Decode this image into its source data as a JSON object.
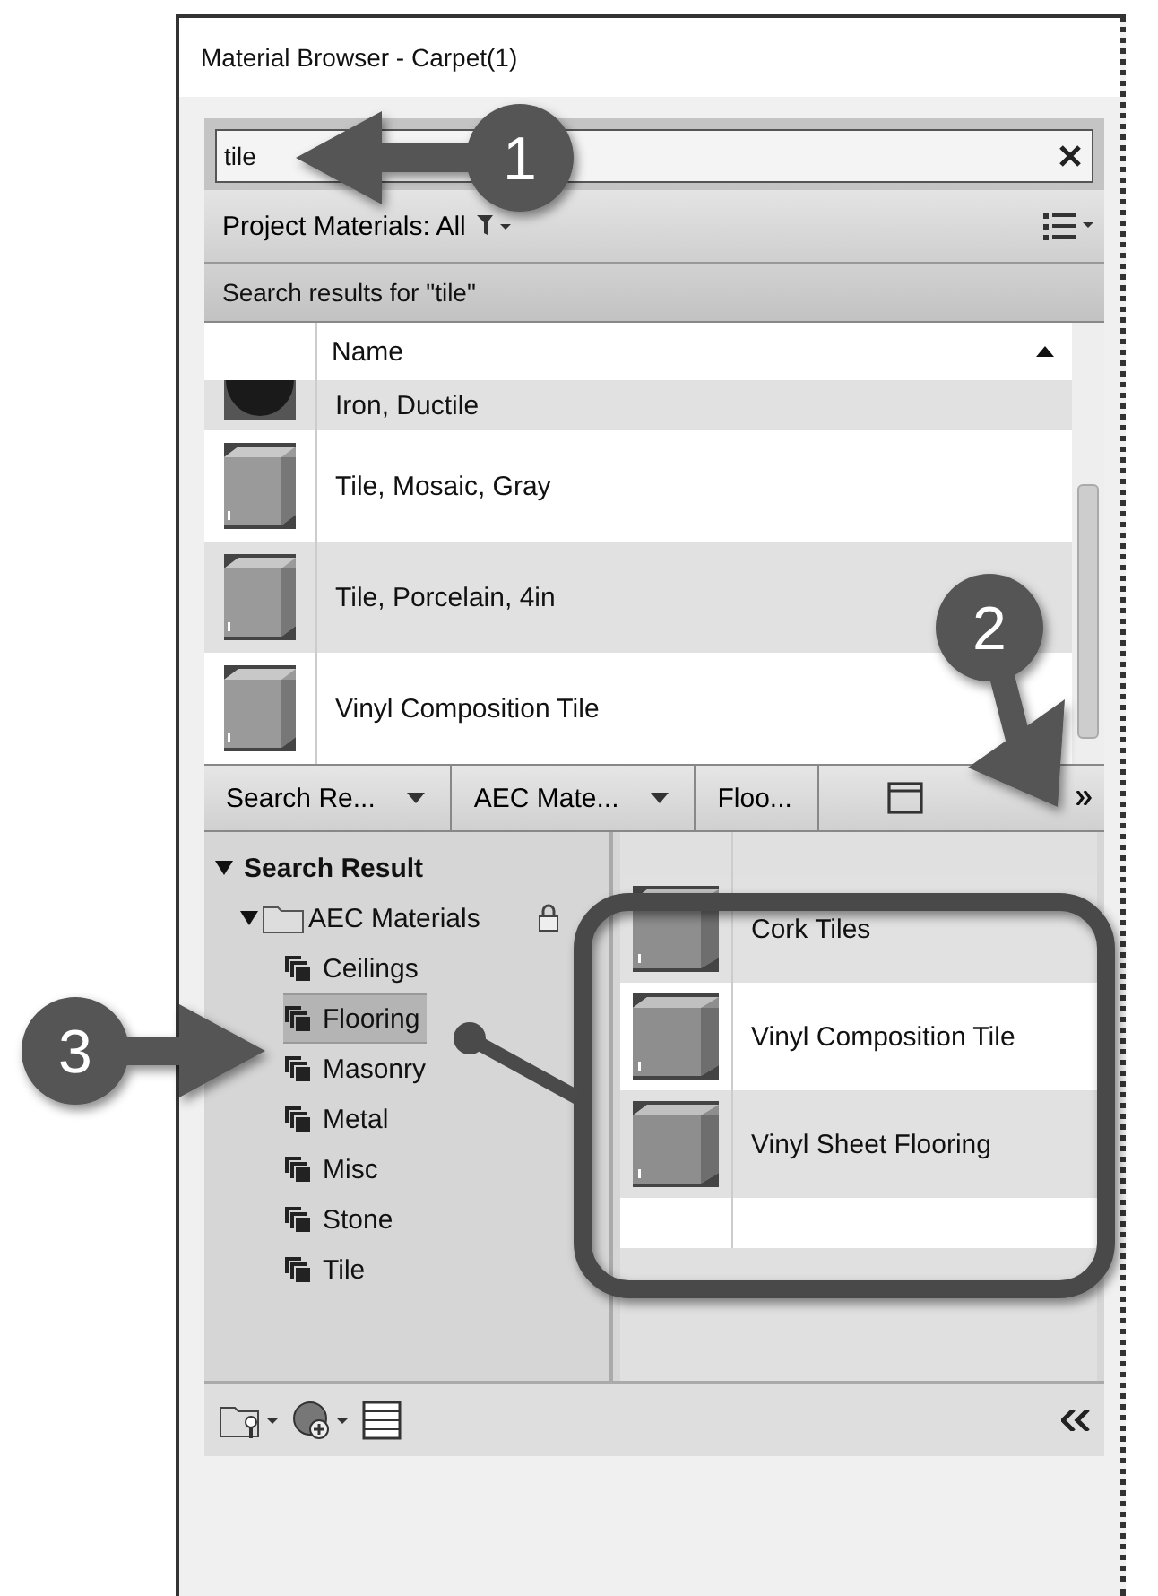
{
  "window": {
    "title": "Material Browser - Carpet(1)"
  },
  "search": {
    "value": "tile"
  },
  "filter_bar": {
    "label": "Project Materials: All"
  },
  "results_header": "Search results for \"tile\"",
  "list": {
    "column": "Name",
    "rows": [
      {
        "name": "Iron, Ductile",
        "kind": "sphere"
      },
      {
        "name": "Tile, Mosaic, Gray",
        "kind": "cube"
      },
      {
        "name": "Tile, Porcelain, 4in",
        "kind": "cube"
      },
      {
        "name": "Vinyl Composition Tile",
        "kind": "cube"
      }
    ]
  },
  "breadcrumb": [
    {
      "label": "Search Re...",
      "dropdown": true
    },
    {
      "label": "AEC Mate...",
      "dropdown": true
    },
    {
      "label": "Floo...",
      "dropdown": false
    }
  ],
  "tree": {
    "label": "Search Result",
    "expanded": true,
    "children": [
      {
        "label": "AEC Materials",
        "expanded": true,
        "children": [
          {
            "label": "Ceilings",
            "selected": false
          },
          {
            "label": "Flooring",
            "selected": true
          },
          {
            "label": "Masonry",
            "selected": false
          },
          {
            "label": "Metal",
            "selected": false
          },
          {
            "label": "Misc",
            "selected": false
          },
          {
            "label": "Stone",
            "selected": false
          },
          {
            "label": "Tile",
            "selected": false
          }
        ]
      }
    ]
  },
  "detail_rows": [
    {
      "name": "Cork Tiles"
    },
    {
      "name": "Vinyl Composition Tile"
    },
    {
      "name": "Vinyl Sheet Flooring"
    }
  ],
  "callouts": [
    {
      "number": "1"
    },
    {
      "number": "2"
    },
    {
      "number": "3"
    }
  ]
}
